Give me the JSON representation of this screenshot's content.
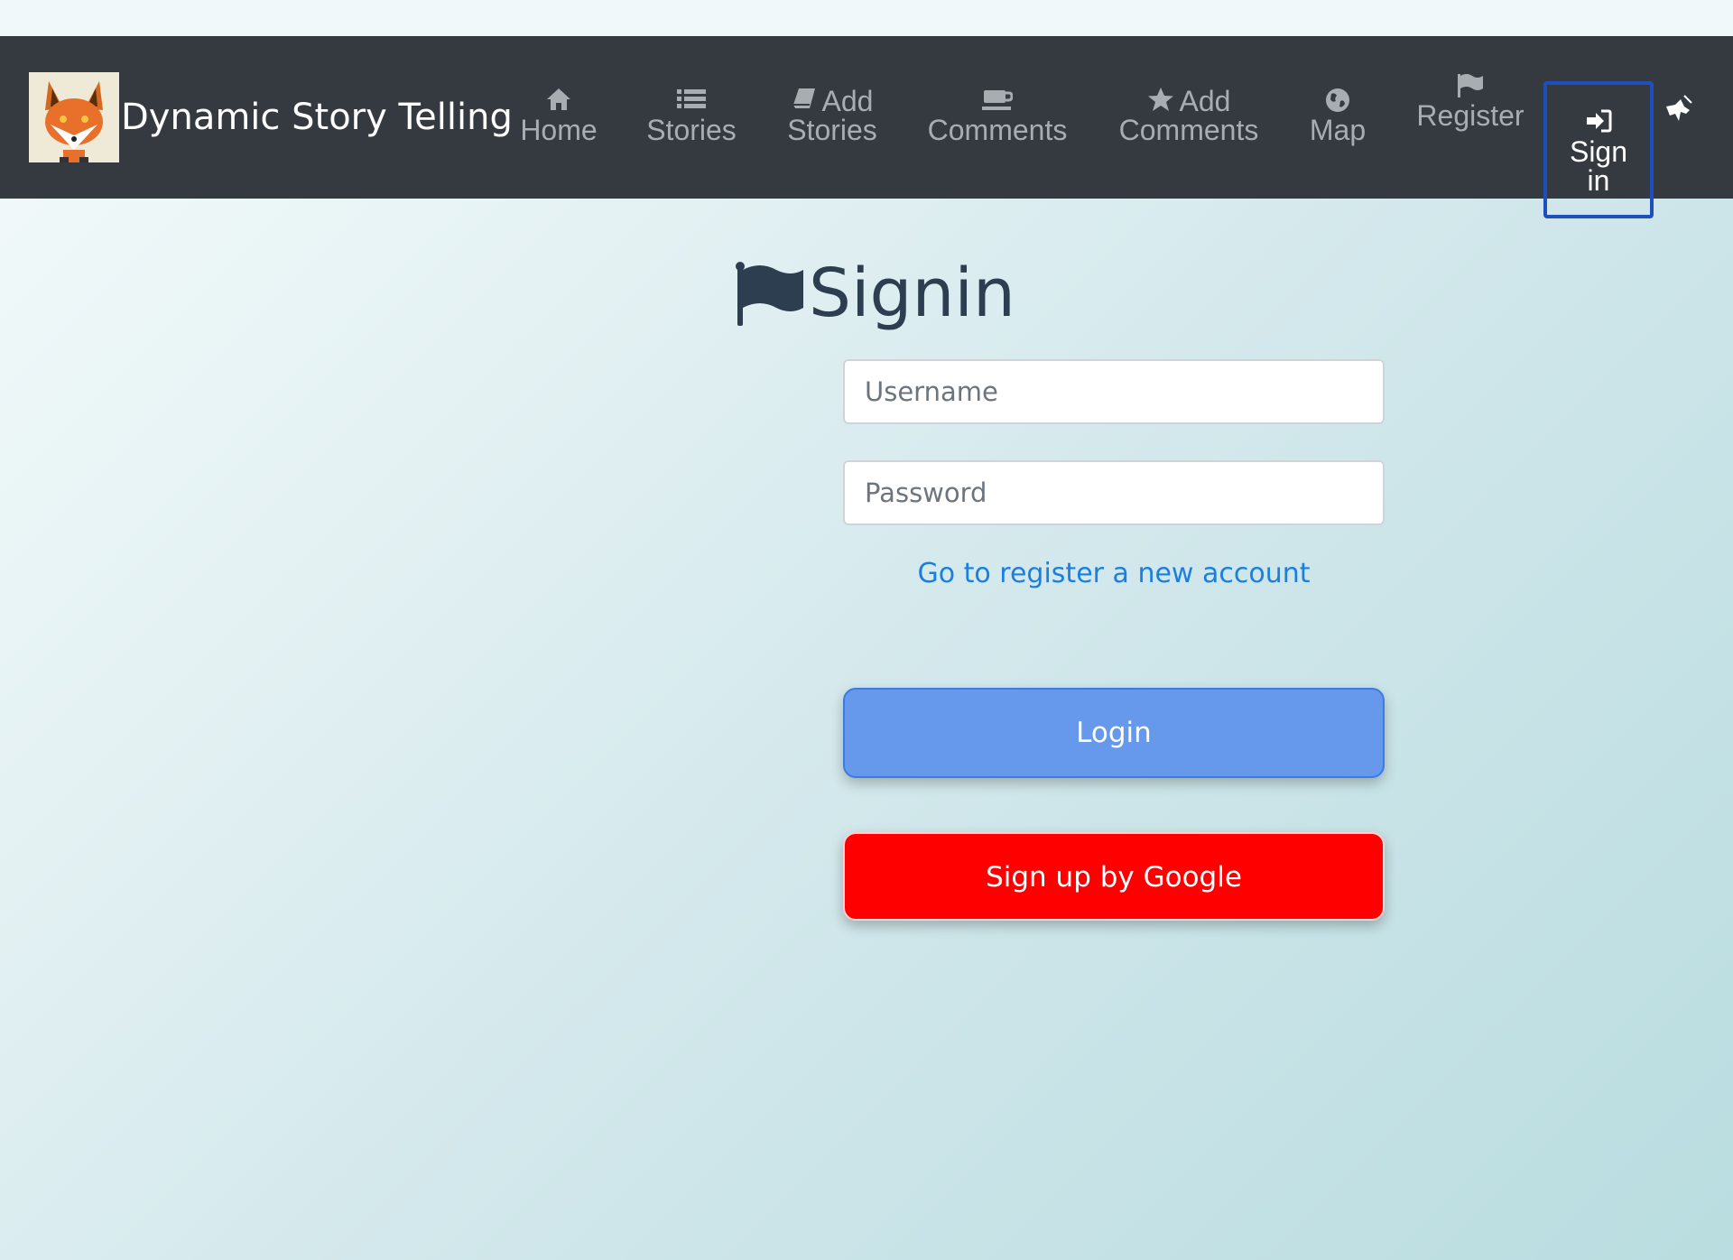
{
  "brand": {
    "name": "Dynamic Story Telling",
    "logo_icon": "fox-logo"
  },
  "nav": {
    "home": {
      "label": "Home",
      "icon": "home-icon"
    },
    "stories": {
      "label": "Stories",
      "icon": "list-icon"
    },
    "add_stories": {
      "label_1": "Add",
      "label_2": "Stories",
      "icon": "book-icon"
    },
    "comments": {
      "label": "Comments",
      "icon": "coffee-icon"
    },
    "add_comments": {
      "label_1": "Add",
      "label_2": "Comments",
      "icon": "star-icon"
    },
    "map": {
      "label": "Map",
      "icon": "globe-icon"
    },
    "register": {
      "label": "Register",
      "icon": "flag-icon"
    },
    "signin": {
      "label_1": "Sign",
      "label_2": "in",
      "icon": "sign-in-icon"
    }
  },
  "page": {
    "title": "Signin",
    "title_icon": "flag-icon"
  },
  "form": {
    "username_placeholder": "Username",
    "password_placeholder": "Password",
    "register_link": "Go to register a new account",
    "login_button": "Login",
    "google_button": "Sign up by Google"
  },
  "colors": {
    "navbar": "#343a40",
    "active_border": "#1f4fbf",
    "title": "#2d3e50",
    "link": "#1a7fe0",
    "login": "#6699eb",
    "google": "#ff0000"
  }
}
